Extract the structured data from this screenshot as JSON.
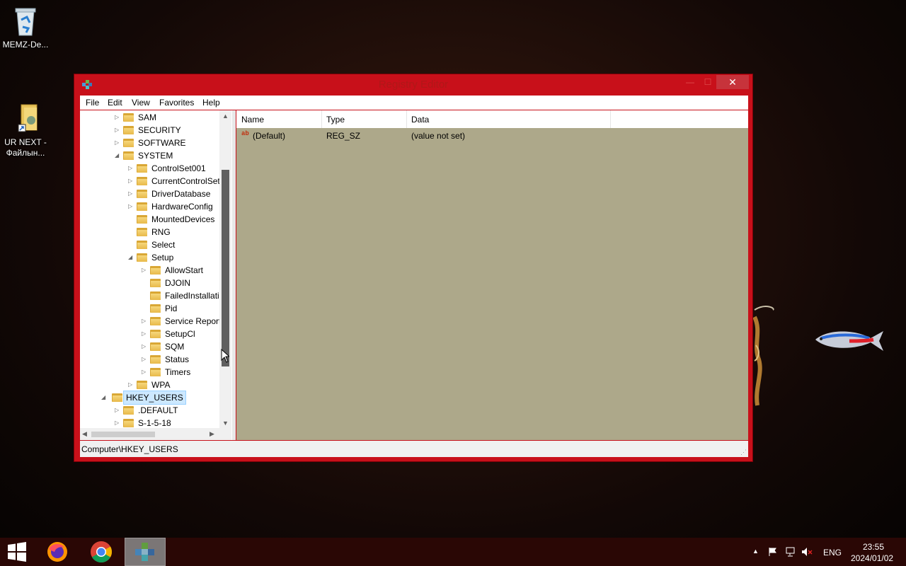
{
  "desktop": {
    "icons": [
      {
        "label": "MEMZ-De...",
        "icon": "recycle-bin-icon"
      },
      {
        "label": "UR NEXT -\nФайлын...",
        "icon": "folder-shortcut-icon"
      }
    ]
  },
  "window": {
    "title": "Registry Editor",
    "minimize_label": "—",
    "maximize_label": "☐",
    "close_label": "✕"
  },
  "menu": {
    "items": [
      "File",
      "Edit",
      "View",
      "Favorites",
      "Help"
    ]
  },
  "tree": {
    "rows": [
      {
        "label": "SAM",
        "expander": "▷"
      },
      {
        "label": "SECURITY",
        "expander": "▷"
      },
      {
        "label": "SOFTWARE",
        "expander": "▷"
      },
      {
        "label": "SYSTEM",
        "expander": "◢"
      },
      {
        "label": "ControlSet001",
        "expander": "▷"
      },
      {
        "label": "CurrentControlSet",
        "expander": "▷"
      },
      {
        "label": "DriverDatabase",
        "expander": "▷"
      },
      {
        "label": "HardwareConfig",
        "expander": "▷"
      },
      {
        "label": "MountedDevices",
        "expander": ""
      },
      {
        "label": "RNG",
        "expander": ""
      },
      {
        "label": "Select",
        "expander": ""
      },
      {
        "label": "Setup",
        "expander": "◢"
      },
      {
        "label": "AllowStart",
        "expander": "▷"
      },
      {
        "label": "DJOIN",
        "expander": ""
      },
      {
        "label": "FailedInstallati",
        "expander": ""
      },
      {
        "label": "Pid",
        "expander": ""
      },
      {
        "label": "Service Report",
        "expander": "▷"
      },
      {
        "label": "SetupCl",
        "expander": "▷"
      },
      {
        "label": "SQM",
        "expander": "▷"
      },
      {
        "label": "Status",
        "expander": "▷"
      },
      {
        "label": "Timers",
        "expander": "▷"
      },
      {
        "label": "WPA",
        "expander": "▷"
      },
      {
        "label": "HKEY_USERS",
        "expander": "◢"
      },
      {
        "label": ".DEFAULT",
        "expander": "▷"
      },
      {
        "label": "S-1-5-18",
        "expander": "▷"
      }
    ]
  },
  "list": {
    "columns": [
      "Name",
      "Type",
      "Data"
    ],
    "rows": [
      {
        "name": "(Default)",
        "type": "REG_SZ",
        "data": "(value not set)",
        "icon": "string-value-icon"
      }
    ]
  },
  "status": {
    "path": "Computer\\HKEY_USERS"
  },
  "taskbar": {
    "items": [
      "start-icon",
      "firefox-icon",
      "chrome-icon",
      "registry-editor-icon"
    ],
    "tray": {
      "language": "ENG",
      "time": "23:55",
      "date": "2024/01/02"
    }
  },
  "colors": {
    "window_frame": "#c8101a",
    "list_background": "#ada88a",
    "selection": "#cce8ff"
  }
}
